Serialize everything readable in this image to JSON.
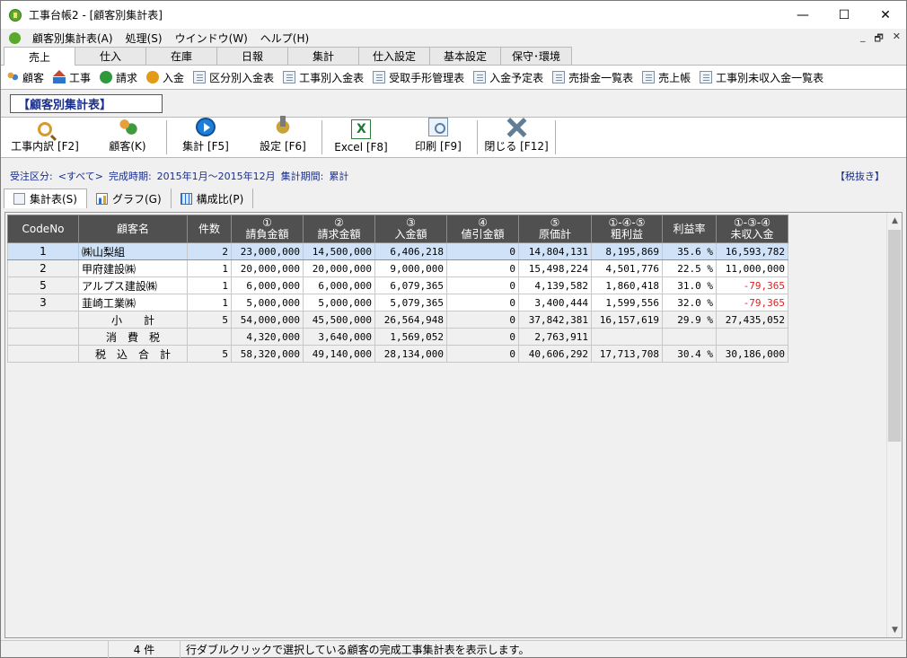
{
  "window": {
    "title": "工事台帳2 - [顧客別集計表]",
    "minimize": "—",
    "maximize": "☐",
    "close": "✕"
  },
  "menu": {
    "items": [
      "顧客別集計表(A)",
      "処理(S)",
      "ウインドウ(W)",
      "ヘルプ(H)"
    ],
    "mdi": [
      "_",
      "🗗",
      "✕"
    ]
  },
  "tabs": [
    "売上",
    "仕入",
    "在庫",
    "日報",
    "集計",
    "仕入設定",
    "基本設定",
    "保守･環境"
  ],
  "shortcuts": [
    {
      "label": "顧客",
      "icon": "customer-icon"
    },
    {
      "label": "工事",
      "icon": "house-icon"
    },
    {
      "label": "請求",
      "icon": "dollar-icon"
    },
    {
      "label": "入金",
      "icon": "yen-icon"
    },
    {
      "label": "区分別入金表",
      "icon": "report-icon"
    },
    {
      "label": "工事別入金表",
      "icon": "report-icon"
    },
    {
      "label": "受取手形管理表",
      "icon": "report-icon"
    },
    {
      "label": "入金予定表",
      "icon": "report-icon"
    },
    {
      "label": "売掛金一覧表",
      "icon": "report-icon"
    },
    {
      "label": "売上帳",
      "icon": "report-icon"
    },
    {
      "label": "工事別未収入金一覧表",
      "icon": "report-icon"
    }
  ],
  "section_title": "【顧客別集計表】",
  "toolbar": [
    {
      "label": "工事内訳 [F2]",
      "icon": "magnifier-icon"
    },
    {
      "label": "顧客(K)",
      "icon": "customers-icon"
    },
    {
      "label": "集計 [F5]",
      "icon": "play-icon"
    },
    {
      "label": "設定 [F6]",
      "icon": "settings-icon"
    },
    {
      "label": "Excel [F8]",
      "icon": "excel-icon"
    },
    {
      "label": "印刷 [F9]",
      "icon": "print-icon"
    },
    {
      "label": "閉じる [F12]",
      "icon": "close-x-icon"
    }
  ],
  "filter": {
    "order_label": "受注区分:",
    "order_value": "<すべて>",
    "period_label": "完成時期:",
    "period_value": "2015年1月～2015年12月",
    "agg_label": "集計期間:",
    "agg_value": "累計"
  },
  "tax_flag": "【税抜き】",
  "view_tabs": [
    "集計表(S)",
    "グラフ(G)",
    "構成比(P)"
  ],
  "grid": {
    "headers": [
      [
        "CodeNo"
      ],
      [
        "顧客名"
      ],
      [
        "件数"
      ],
      [
        "①",
        "請負金額"
      ],
      [
        "②",
        "請求金額"
      ],
      [
        "③",
        "入金額"
      ],
      [
        "④",
        "値引金額"
      ],
      [
        "⑤",
        "原価計"
      ],
      [
        "①-④-⑤",
        "粗利益"
      ],
      [
        "利益率"
      ],
      [
        "①-③-④",
        "未収入金"
      ]
    ],
    "rows": [
      {
        "code": "1",
        "name": "㈱山梨組",
        "count": "2",
        "contract": "23,000,000",
        "billed": "14,500,000",
        "received": "6,406,218",
        "discount": "0",
        "cost": "14,804,131",
        "gross": "8,195,869",
        "rate": "35.6 %",
        "unpaid": "16,593,782",
        "neg": false
      },
      {
        "code": "2",
        "name": "甲府建設㈱",
        "count": "1",
        "contract": "20,000,000",
        "billed": "20,000,000",
        "received": "9,000,000",
        "discount": "0",
        "cost": "15,498,224",
        "gross": "4,501,776",
        "rate": "22.5 %",
        "unpaid": "11,000,000",
        "neg": false
      },
      {
        "code": "5",
        "name": "アルプス建設㈱",
        "count": "1",
        "contract": "6,000,000",
        "billed": "6,000,000",
        "received": "6,079,365",
        "discount": "0",
        "cost": "4,139,582",
        "gross": "1,860,418",
        "rate": "31.0 %",
        "unpaid": "-79,365",
        "neg": true
      },
      {
        "code": "3",
        "name": "韮崎工業㈱",
        "count": "1",
        "contract": "5,000,000",
        "billed": "5,000,000",
        "received": "5,079,365",
        "discount": "0",
        "cost": "3,400,444",
        "gross": "1,599,556",
        "rate": "32.0 %",
        "unpaid": "-79,365",
        "neg": true
      }
    ],
    "summary": [
      {
        "label": "小　　計",
        "count": "5",
        "contract": "54,000,000",
        "billed": "45,500,000",
        "received": "26,564,948",
        "discount": "0",
        "cost": "37,842,381",
        "gross": "16,157,619",
        "rate": "29.9 %",
        "unpaid": "27,435,052"
      },
      {
        "label": "消　費　税",
        "count": "",
        "contract": "4,320,000",
        "billed": "3,640,000",
        "received": "1,569,052",
        "discount": "0",
        "cost": "2,763,911",
        "gross": "",
        "rate": "",
        "unpaid": ""
      },
      {
        "label": "税　込　合　計",
        "count": "5",
        "contract": "58,320,000",
        "billed": "49,140,000",
        "received": "28,134,000",
        "discount": "0",
        "cost": "40,606,292",
        "gross": "17,713,708",
        "rate": "30.4 %",
        "unpaid": "30,186,000"
      }
    ]
  },
  "status": {
    "count": "4 件",
    "message": "行ダブルクリックで選択している顧客の完成工事集計表を表示します。"
  }
}
